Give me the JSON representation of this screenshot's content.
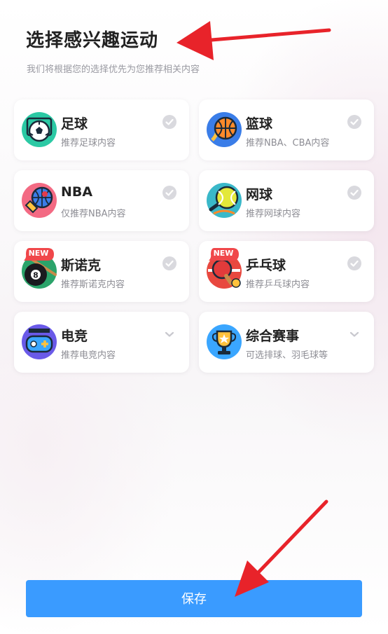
{
  "header": {
    "title": "选择感兴趣运动",
    "subtitle": "我们将根据您的选择优先为您推荐相关内容"
  },
  "sports": [
    {
      "name": "足球",
      "desc": "推荐足球内容",
      "icon": "soccer-ball-icon",
      "state": "check",
      "badge": ""
    },
    {
      "name": "篮球",
      "desc": "推荐NBA、CBA内容",
      "icon": "basketball-icon",
      "state": "check",
      "badge": ""
    },
    {
      "name": "NBA",
      "desc": "仅推荐NBA内容",
      "icon": "nba-basketball-icon",
      "state": "check",
      "badge": ""
    },
    {
      "name": "网球",
      "desc": "推荐网球内容",
      "icon": "tennis-ball-icon",
      "state": "check",
      "badge": ""
    },
    {
      "name": "斯诺克",
      "desc": "推荐斯诺克内容",
      "icon": "billiard-ball-icon",
      "state": "check",
      "badge": "NEW"
    },
    {
      "name": "乒乓球",
      "desc": "推荐乒乓球内容",
      "icon": "ping-pong-paddle-icon",
      "state": "check",
      "badge": "NEW"
    },
    {
      "name": "电竞",
      "desc": "推荐电竞内容",
      "icon": "gamepad-icon",
      "state": "expand",
      "badge": ""
    },
    {
      "name": "综合赛事",
      "desc": "可选排球、羽毛球等",
      "icon": "trophy-icon",
      "state": "expand",
      "badge": ""
    }
  ],
  "footer": {
    "save_label": "保存"
  },
  "colors": {
    "accent": "#3a9bff",
    "badge": "#f0474a",
    "arrow": "#e8232a",
    "check": "#d9d9de"
  }
}
